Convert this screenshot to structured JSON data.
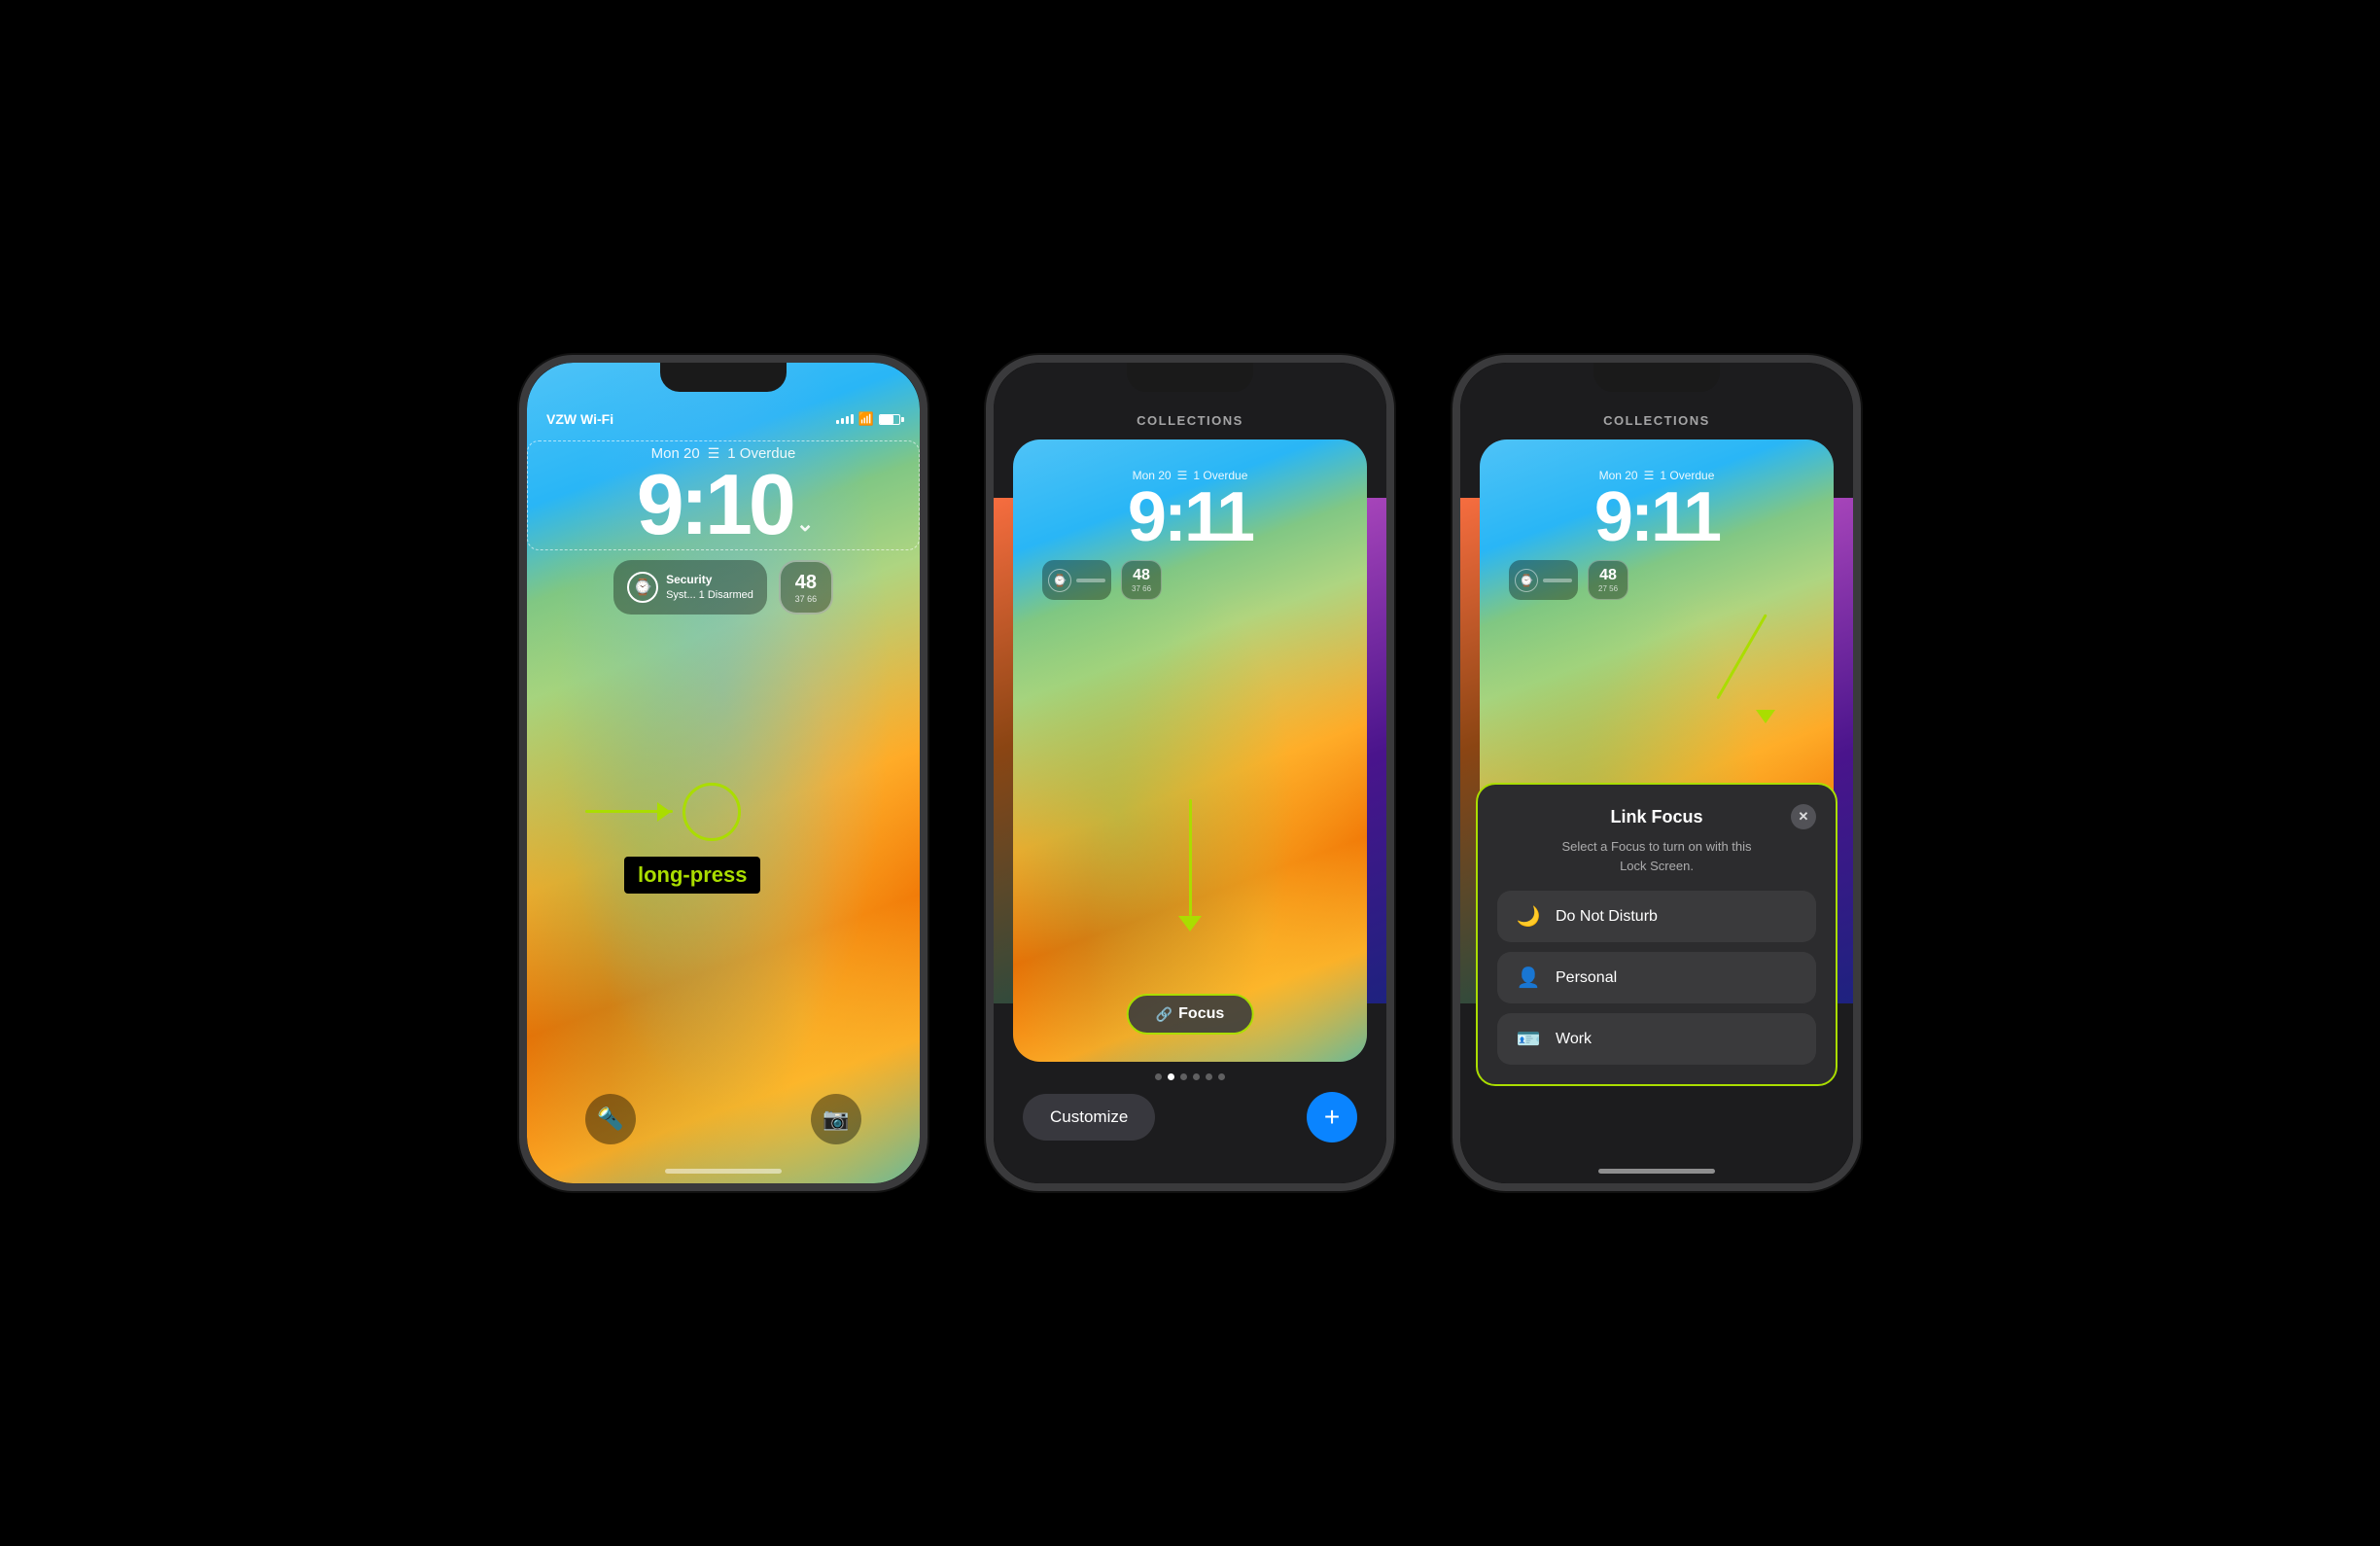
{
  "phone1": {
    "status": {
      "carrier": "VZW Wi-Fi",
      "time_hidden": true
    },
    "date_label": "Mon 20",
    "overdue_label": "1 Overdue",
    "time": "9:10",
    "widget_security_title": "Security",
    "widget_security_sub": "Syst... 1 Disarmed",
    "widget_temp_main": "48",
    "widget_temp_range": "37  66",
    "annotation_label": "long-press",
    "bottom_icon_flashlight": "🔦",
    "bottom_icon_camera": "📷"
  },
  "phone2": {
    "header": "COLLECTIONS",
    "time": "9:11",
    "date_label": "Mon 20",
    "overdue_label": "1 Overdue",
    "widget_temp": "48",
    "widget_temp_range": "37 66",
    "focus_button_label": "Focus",
    "dots": [
      false,
      true,
      false,
      false,
      false,
      false
    ],
    "customize_label": "Customize",
    "add_label": "+"
  },
  "phone3": {
    "header": "COLLECTIONS",
    "time": "9:11",
    "date_label": "Mon 20",
    "overdue_label": "1 Overdue",
    "widget_temp": "48",
    "widget_temp_range": "27 56",
    "link_focus": {
      "title": "Link Focus",
      "subtitle": "Select a Focus to turn on with this\nLock Screen.",
      "close_icon": "✕",
      "options": [
        {
          "icon": "🌙",
          "label": "Do Not Disturb"
        },
        {
          "icon": "👤",
          "label": "Personal"
        },
        {
          "icon": "🪪",
          "label": "Work"
        }
      ]
    }
  },
  "colors": {
    "accent_green": "#aadd00",
    "blue": "#0a84ff",
    "panel_bg": "#2c2c2e",
    "option_bg": "#3a3a3c"
  }
}
